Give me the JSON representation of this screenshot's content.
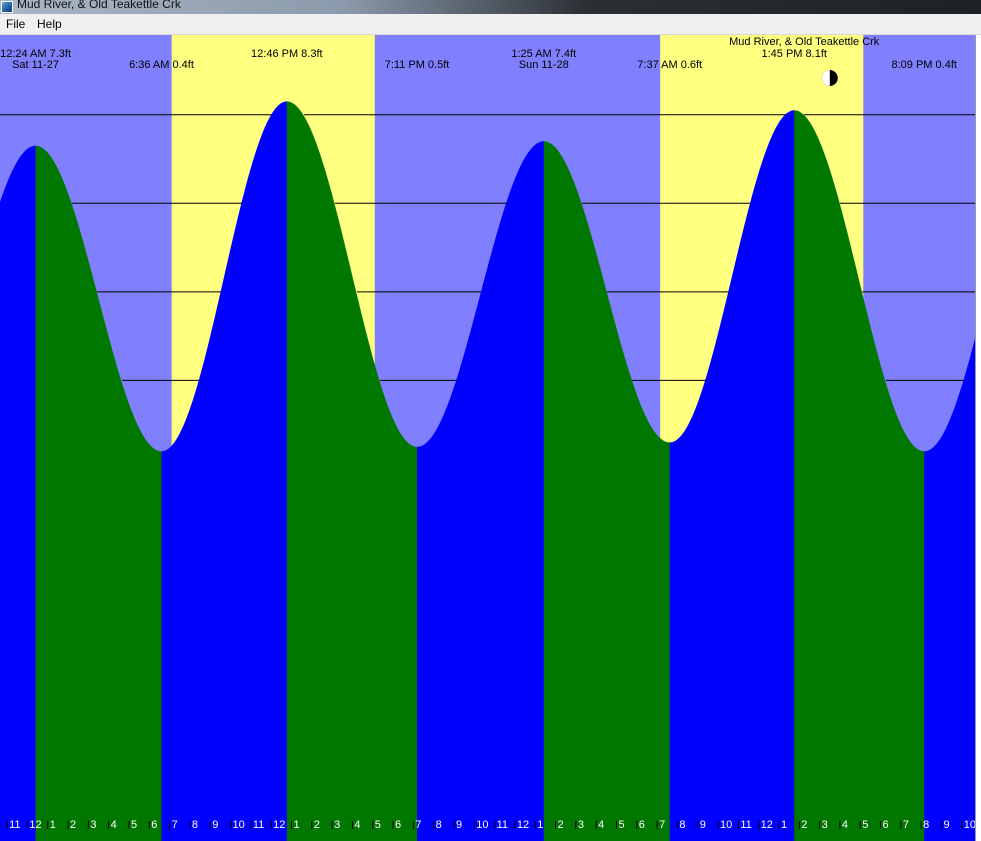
{
  "window": {
    "title": "Mud River, & Old Teakettle Crk",
    "icon": "app-icon"
  },
  "menu": {
    "file": "File",
    "help": "Help"
  },
  "colors": {
    "night": "#8080ff",
    "day": "#ffff80",
    "rising": "#0000ff",
    "falling": "#007800",
    "grid": "#000000"
  },
  "chart_data": {
    "type": "area",
    "title": "Mud River, & Old Teakettle Crk",
    "xlabel": "",
    "ylabel": "",
    "units": "ft",
    "x_range_hours": [
      -1.35,
      46.65
    ],
    "y_range_ft": [
      -8.4,
      9.8
    ],
    "grid_ft": [
      8,
      6,
      4,
      2,
      0,
      -2
    ],
    "moon": {
      "icon": "half-moon-icon",
      "hour": 39.5,
      "phase": "last-quarter"
    },
    "daylight_periods": [
      {
        "start": 7.1,
        "end": 17.1
      },
      {
        "start": 31.15,
        "end": 41.15
      }
    ],
    "tides": [
      {
        "label": "12:24 AM 7.3ft",
        "date": "Sat 11-27",
        "hour": 0.4,
        "height": 7.3,
        "kind": "high"
      },
      {
        "label": "6:36 AM 0.4ft",
        "hour": 6.6,
        "height": 0.4,
        "kind": "low"
      },
      {
        "label": "12:46 PM 8.3ft",
        "hour": 12.77,
        "height": 8.3,
        "kind": "high"
      },
      {
        "label": "7:11 PM 0.5ft",
        "hour": 19.18,
        "height": 0.5,
        "kind": "low"
      },
      {
        "label": "1:25 AM 7.4ft",
        "date": "Sun 11-28",
        "hour": 25.42,
        "height": 7.4,
        "kind": "high"
      },
      {
        "label": "7:37 AM 0.6ft",
        "hour": 31.62,
        "height": 0.6,
        "kind": "low"
      },
      {
        "label": "1:45 PM 8.1ft",
        "hour": 37.75,
        "height": 8.1,
        "kind": "high"
      },
      {
        "label": "8:09 PM 0.4ft",
        "hour": 44.15,
        "height": 0.4,
        "kind": "low"
      }
    ],
    "hour_ticks": {
      "start_hour": -1,
      "labels": [
        "11",
        "12",
        "1",
        "2",
        "3",
        "4",
        "5",
        "6",
        "7",
        "8",
        "9",
        "10",
        "11",
        "12",
        "1",
        "2",
        "3",
        "4",
        "5",
        "6",
        "7",
        "8",
        "9",
        "10",
        "11",
        "12",
        "1",
        "2",
        "3",
        "4",
        "5",
        "6",
        "7",
        "8",
        "9",
        "10",
        "11",
        "12",
        "1",
        "2",
        "3",
        "4",
        "5",
        "6",
        "7",
        "8",
        "9",
        "10"
      ]
    }
  }
}
